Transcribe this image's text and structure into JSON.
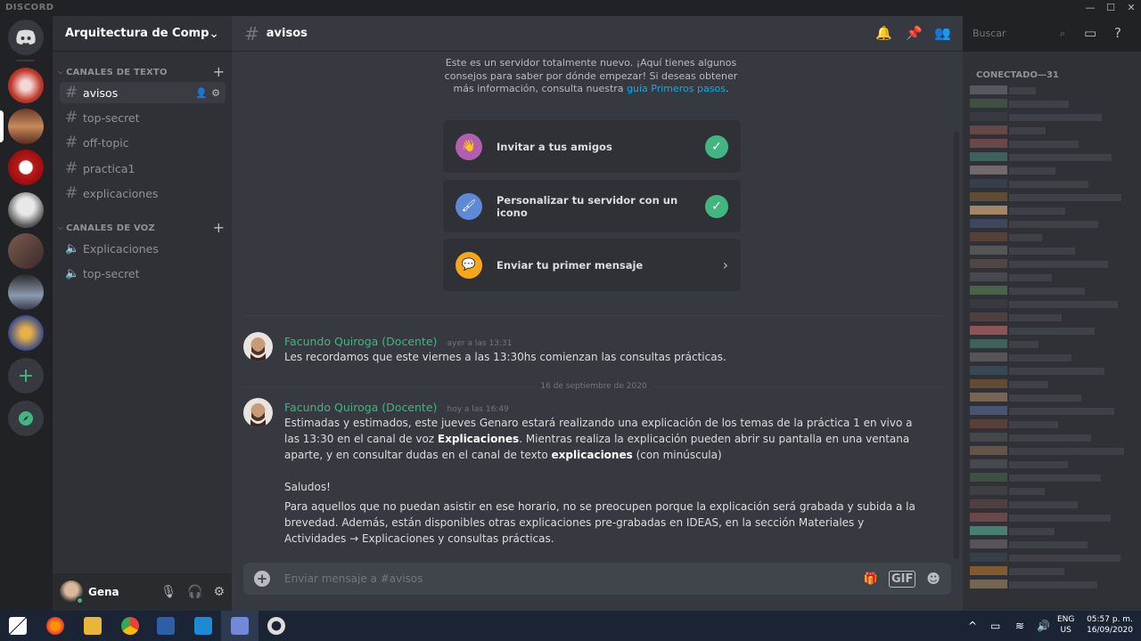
{
  "app": {
    "brand": "DISCORD",
    "window_controls": {
      "minimize": "—",
      "maximize": "☐",
      "close": "✕"
    }
  },
  "guild": {
    "name": "Arquitectura de Computa...",
    "chevron": "⌄"
  },
  "categories": [
    {
      "label": "CANALES DE TEXTO",
      "add": "+"
    },
    {
      "label": "CANALES DE VOZ",
      "add": "+"
    }
  ],
  "text_channels": [
    {
      "name": "avisos",
      "active": true
    },
    {
      "name": "top-secret",
      "active": false
    },
    {
      "name": "off-topic",
      "active": false
    },
    {
      "name": "practica1",
      "active": false
    },
    {
      "name": "explicaciones",
      "active": false
    }
  ],
  "voice_channels": [
    {
      "name": "Explicaciones"
    },
    {
      "name": "top-secret"
    }
  ],
  "user": {
    "name": "Gena"
  },
  "channel": {
    "name": "avisos",
    "search_placeholder": "Buscar"
  },
  "tips": {
    "text": "Este es un servidor totalmente nuevo. ¡Aquí tienes algunos consejos para saber por dónde empezar! Si deseas obtener más información, consulta nuestra",
    "link": "guía Primeros pasos",
    "end": "."
  },
  "cards": [
    {
      "label": "Invitar a tus amigos",
      "done": true,
      "icon_color": "#b25fb0"
    },
    {
      "label": "Personalizar tu servidor con un icono",
      "done": true,
      "icon_color": "#5c8ad6"
    },
    {
      "label": "Enviar tu primer mensaje",
      "done": false,
      "icon_color": "#faa61a"
    }
  ],
  "messages": [
    {
      "author": "Facundo Quiroga (Docente)",
      "timestamp": "ayer a las 13:31",
      "text": "Les recordamos que este viernes a las 13:30hs comienzan las consultas prácticas."
    },
    {
      "author": "Facundo Quiroga (Docente)",
      "timestamp": "hoy a las 16:49",
      "p1a": "Estimadas y estimados, este jueves Genaro estará realizando una explicación de los temas de la práctica 1 en vivo a las 13:30 en el canal de voz ",
      "p1b": "Explicaciones",
      "p1c": ".  Mientras realiza la explicación pueden abrir su pantalla en una ventana aparte, y en consultar dudas en el canal de texto ",
      "p1d": "explicaciones",
      "p1e": " (con minúscula)",
      "p2": "Saludos!",
      "p3": "Para aquellos que no puedan asistir en ese horario, no se preocupen porque la explicación será grabada y subida a la brevedad. Además, están disponibles otras explicaciones pre-grabadas en IDEAS, en la sección Materiales y Actividades → Explicaciones y consultas prácticas."
    }
  ],
  "date_divider": "16 de septiembre de 2020",
  "composer": {
    "placeholder": "Enviar mensaje a #avisos",
    "gif": "GIF"
  },
  "members": {
    "header": "CONECTADO—31"
  },
  "taskbar": {
    "lang": "ENG",
    "region": "US",
    "time": "05:57 p. m.",
    "date": "16/09/2020"
  },
  "colors": {
    "accent": "#7289da",
    "online": "#43b581",
    "link": "#00b0f4"
  }
}
